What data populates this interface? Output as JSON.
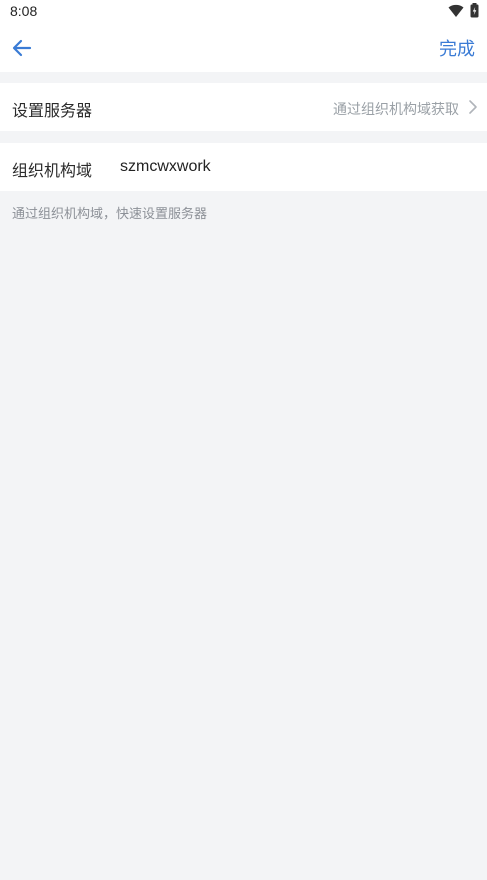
{
  "status_bar": {
    "time": "8:08",
    "icons": [
      "wifi-icon",
      "battery-icon"
    ]
  },
  "nav": {
    "back_icon": "arrow-left-icon",
    "done_label": "完成"
  },
  "server_row": {
    "label": "设置服务器",
    "value": "通过组织机构域获取",
    "chevron_icon": "chevron-right-icon"
  },
  "domain_row": {
    "label": "组织机构域",
    "value": "szmcwxwork"
  },
  "hint": "通过组织机构域，快速设置服务器",
  "colors": {
    "accent": "#3a7bd5",
    "background": "#f3f4f6",
    "secondary_text": "#9aa0a6"
  }
}
